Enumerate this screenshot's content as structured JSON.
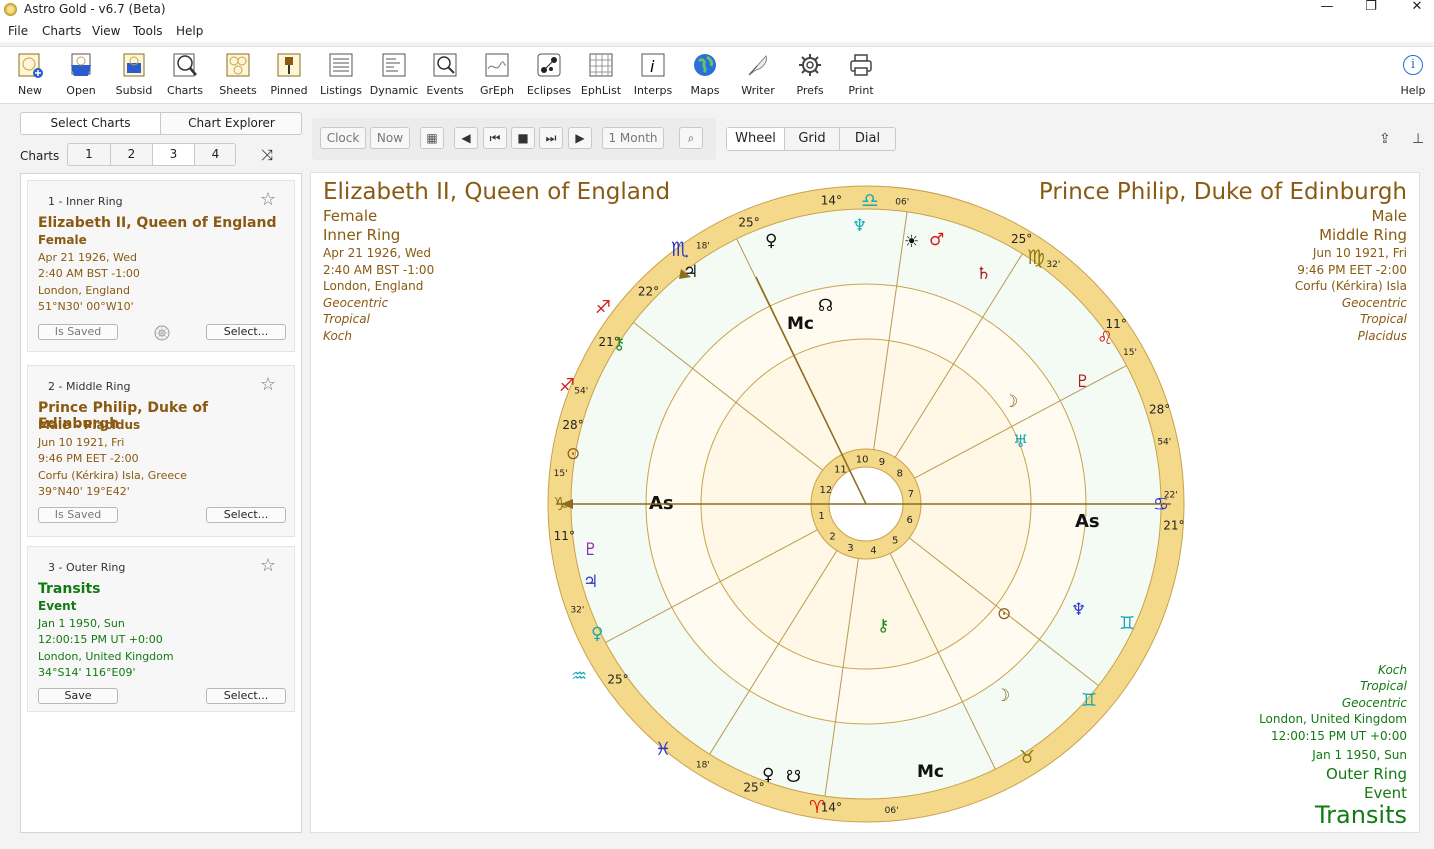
{
  "window": {
    "title": "Astro Gold - v6.7 (Beta)",
    "min": "—",
    "max": "❐",
    "close": "✕"
  },
  "menu": [
    "File",
    "Charts",
    "View",
    "Tools",
    "Help"
  ],
  "toolbar": {
    "items": [
      "New",
      "Open",
      "Subsid",
      "Charts",
      "Sheets",
      "Pinned",
      "Listings",
      "Dynamic",
      "Events",
      "GrEph",
      "Eclipses",
      "EphList",
      "Interps",
      "Maps",
      "Writer",
      "Prefs",
      "Print"
    ],
    "help": "Help"
  },
  "left": {
    "tabs": {
      "select": "Select Charts",
      "explorer": "Chart Explorer",
      "active": "Select Charts"
    },
    "charts_label": "Charts",
    "chart_numbers": [
      "1",
      "2",
      "3",
      "4"
    ],
    "active_number": "3",
    "cards": [
      {
        "ring": "1 - Inner Ring",
        "name": "Elizabeth II, Queen of England",
        "sub": "Female",
        "info": [
          "Apr 21 1926, Wed",
          "2:40 AM BST -1:00",
          "London, England",
          "51°N30' 00°W10'"
        ],
        "btn_left": "Is Saved",
        "btn_right": "Select..."
      },
      {
        "ring": "2 - Middle Ring",
        "name": "Prince Philip, Duke of Edinburgh",
        "sub": "Male - Placidus",
        "info": [
          "Jun 10 1921, Fri",
          "9:46 PM EET -2:00",
          "Corfu (Kérkira) Isla, Greece",
          "39°N40' 19°E42'"
        ],
        "btn_left": "Is Saved",
        "btn_right": "Select..."
      },
      {
        "ring": "3 - Outer Ring",
        "name": "Transits",
        "sub": "Event",
        "info": [
          "Jan 1 1950, Sun",
          "12:00:15 PM UT +0:00",
          "London, United Kingdom",
          "34°S14' 116°E09'"
        ],
        "btn_left": "Save",
        "btn_right": "Select..."
      }
    ]
  },
  "controls": {
    "clock": "Clock",
    "now": "Now",
    "step": "1 Month"
  },
  "view_tabs": {
    "wheel": "Wheel",
    "grid": "Grid",
    "dial": "Dial",
    "active": "Wheel"
  },
  "chart": {
    "inner": {
      "name": "Elizabeth II, Queen of England",
      "gender": "Female",
      "ring": "Inner Ring",
      "date": "Apr 21 1926, Wed",
      "time": "2:40 AM BST -1:00",
      "place": "London, England",
      "zodiac": "Geocentric",
      "type": "Tropical",
      "houses": "Koch"
    },
    "middle": {
      "name": "Prince Philip, Duke of Edinburgh",
      "gender": "Male",
      "ring": "Middle Ring",
      "date": "Jun 10 1921, Fri",
      "time": "9:46 PM EET -2:00",
      "place": "Corfu (Kérkira) Isla",
      "zodiac": "Geocentric",
      "type": "Tropical",
      "houses": "Placidus"
    },
    "outer": {
      "houses": "Koch",
      "type": "Tropical",
      "zodiac": "Geocentric",
      "place": "London, United Kingdom",
      "time": "12:00:15 PM UT +0:00",
      "date": "Jan 1 1950, Sun",
      "ring": "Outer Ring",
      "kind": "Event",
      "name": "Transits"
    },
    "house_numbers": [
      "1",
      "2",
      "3",
      "4",
      "5",
      "6",
      "7",
      "8",
      "9",
      "10",
      "11",
      "12"
    ],
    "cusp_degrees": [
      "14°",
      "06'",
      "25°",
      "18'",
      "22°",
      "21°",
      "54'",
      "28°",
      "15'",
      "11°",
      "32'",
      "25°",
      "14°",
      "06'",
      "25°",
      "18'",
      "22'",
      "21°",
      "54'",
      "28°",
      "15'",
      "11°",
      "32'",
      "25°"
    ],
    "colors": {
      "ring": "#f5d98a",
      "ring_stroke": "#c8a24a",
      "inner": "#fff8e6",
      "axis": "#8a6d1e",
      "fire": "#d41c1c",
      "earth": "#8a7a12",
      "air": "#18a8b8",
      "water": "#2a34c8"
    }
  }
}
